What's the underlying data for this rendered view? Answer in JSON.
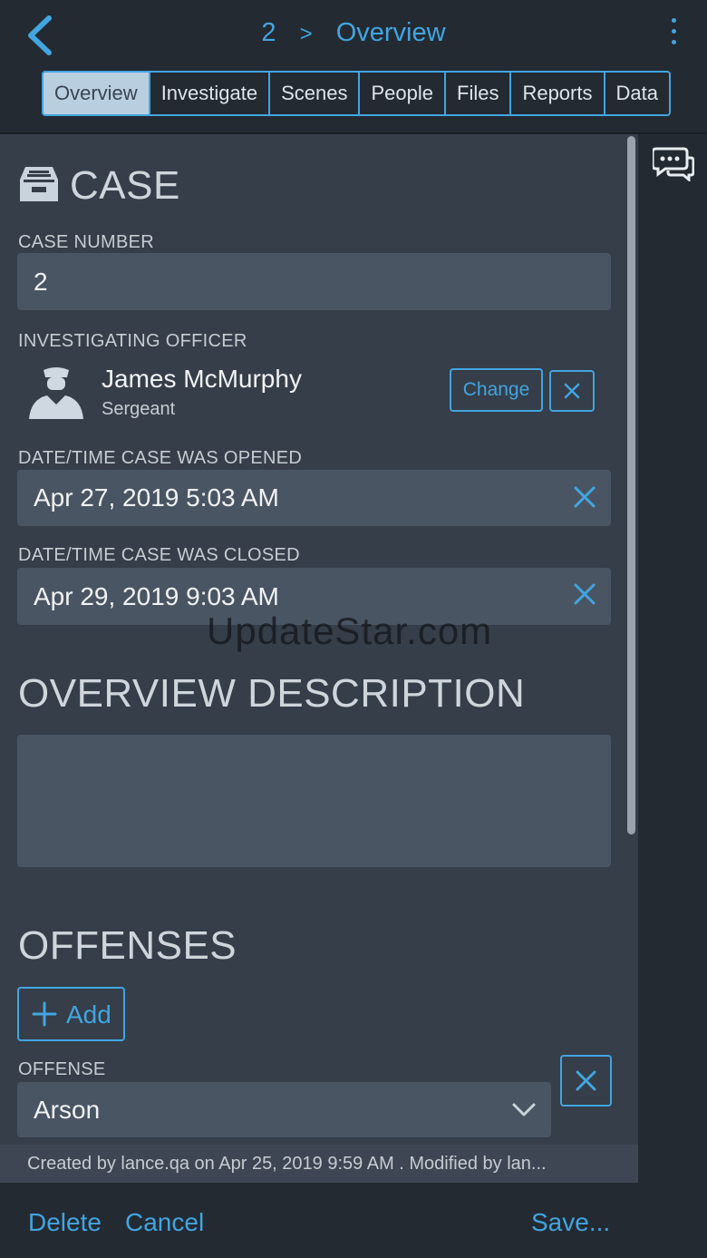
{
  "header": {
    "case_id": "2",
    "separator": ">",
    "page": "Overview"
  },
  "tabs": [
    "Overview",
    "Investigate",
    "Scenes",
    "People",
    "Files",
    "Reports",
    "Data"
  ],
  "case": {
    "title": "CASE",
    "case_number_label": "CASE NUMBER",
    "case_number": "2",
    "officer_label": "INVESTIGATING OFFICER",
    "officer_name": "James McMurphy",
    "officer_rank": "Sergeant",
    "change_label": "Change",
    "opened_label": "DATE/TIME CASE WAS OPENED",
    "opened_value": "Apr 27, 2019 5:03 AM",
    "closed_label": "DATE/TIME CASE WAS CLOSED",
    "closed_value": "Apr 29, 2019 9:03 AM"
  },
  "overview": {
    "title": "OVERVIEW DESCRIPTION",
    "description": ""
  },
  "offenses": {
    "title": "OFFENSES",
    "add_label": "Add",
    "offense_label": "OFFENSE",
    "offense_value": "Arson"
  },
  "watermark": "UpdateStar.com",
  "meta": "Created by lance.qa on Apr 25, 2019 9:59 AM . Modified by lan...",
  "actions": {
    "delete": "Delete",
    "cancel": "Cancel",
    "save": "Save..."
  },
  "colors": {
    "accent": "#42a5e0",
    "background": "#232a32",
    "panel": "#353e49",
    "field": "#4a5563"
  }
}
